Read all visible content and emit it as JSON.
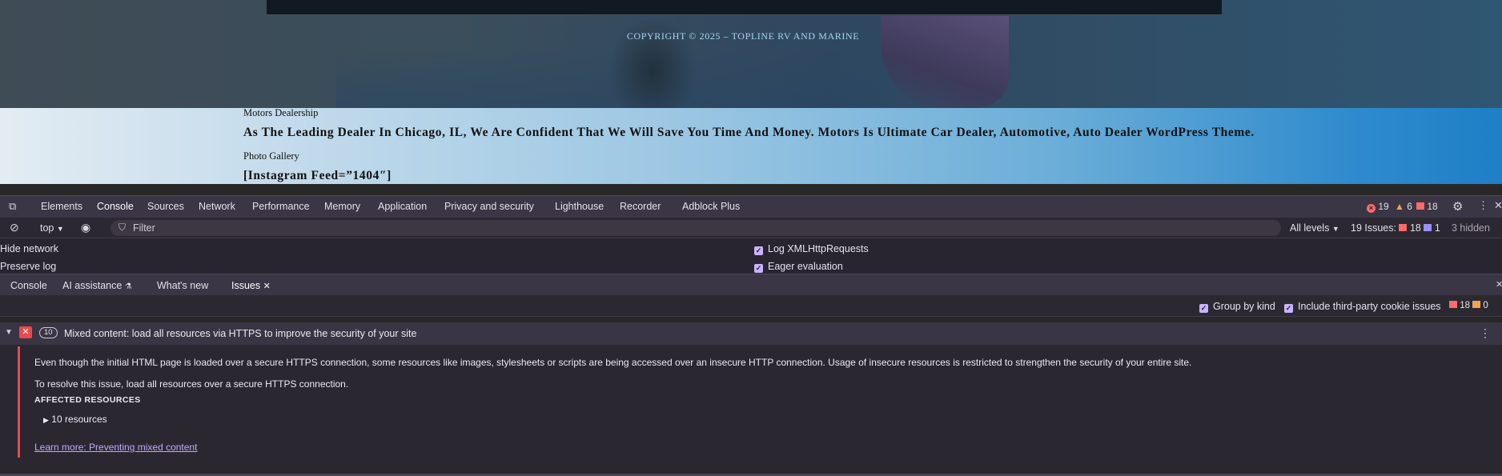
{
  "page": {
    "copyright": "COPYRIGHT © 2025 – TOPLINE RV AND MARINE",
    "site_name": "Motors Dealership",
    "tagline": "As The Leading Dealer In Chicago, IL, We Are Confident That We Will Save You Time And Money. Motors Is Ultimate Car Dealer, Automotive, Auto Dealer WordPress Theme.",
    "gallery_label": "Photo Gallery",
    "shortcode": "[Instagram Feed=”1404″]"
  },
  "devtools": {
    "tabs": [
      "Elements",
      "Console",
      "Sources",
      "Network",
      "Performance",
      "Memory",
      "Application",
      "Privacy and security",
      "Lighthouse",
      "Recorder",
      "Adblock Plus"
    ],
    "active_tab": "Console",
    "counts": {
      "errors": "19",
      "warnings": "6",
      "issues": "18"
    },
    "console_toolbar": {
      "context": "top",
      "filter_placeholder": "Filter",
      "levels": "All levels",
      "issues_label": "19 Issues:",
      "issues_red": "18",
      "issues_purple": "1",
      "hidden": "3 hidden"
    },
    "settings": {
      "hide_network": "Hide network",
      "preserve_log": "Preserve log",
      "log_xhr": "Log XMLHttpRequests",
      "eager_eval": "Eager evaluation"
    },
    "drawer_tabs": {
      "console": "Console",
      "ai": "AI assistance",
      "whats_new": "What's new",
      "issues": "Issues"
    },
    "issues_toolbar": {
      "group_by_kind": "Group by kind",
      "include_third_party": "Include third-party cookie issues",
      "red_count": "18",
      "orange_count": "0"
    },
    "issue": {
      "count": "10",
      "title": "Mixed content: load all resources via HTTPS to improve the security of your site",
      "description": "Even though the initial HTML page is loaded over a secure HTTPS connection, some resources like images, stylesheets or scripts are being accessed over an insecure HTTP connection. Usage of insecure resources is restricted to strengthen the security of your entire site.",
      "resolution": "To resolve this issue, load all resources over a secure HTTPS connection.",
      "affected_heading": "AFFECTED RESOURCES",
      "resources": "10 resources",
      "learn_more": "Learn more: Preventing mixed content"
    }
  }
}
